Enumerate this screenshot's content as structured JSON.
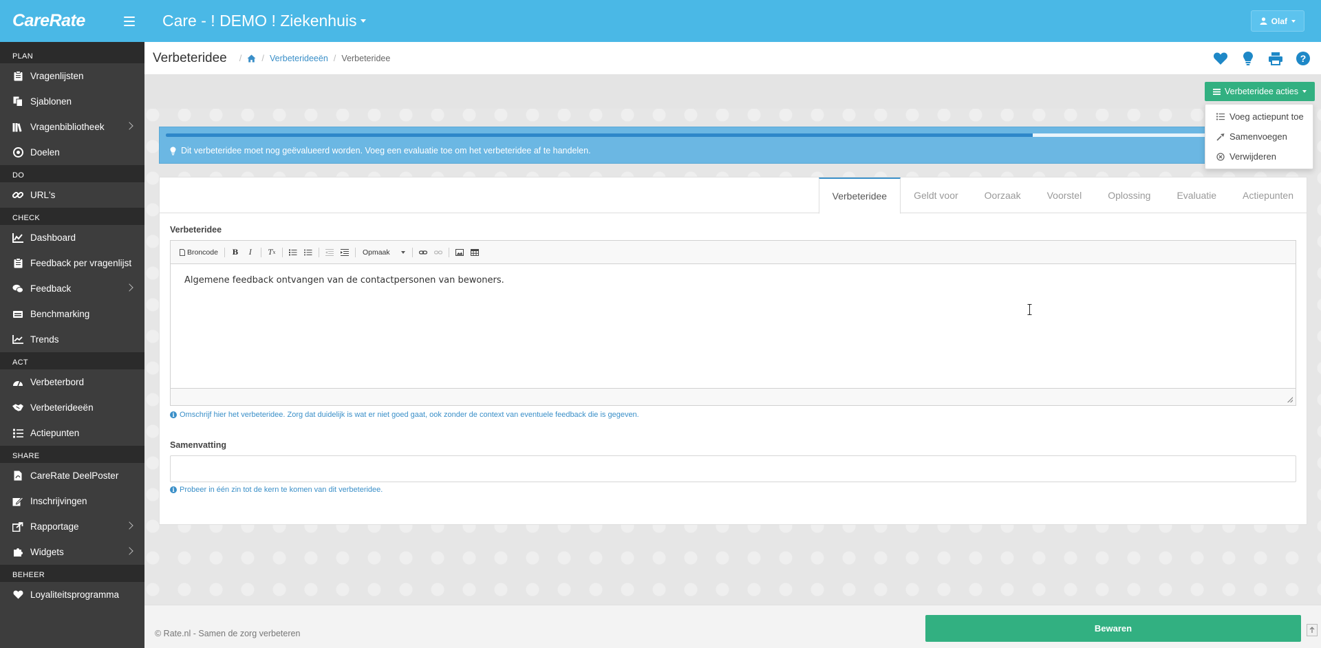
{
  "header": {
    "brand": "CareRate",
    "site_title": "Care - ! DEMO ! Ziekenhuis",
    "user": "Olaf"
  },
  "sidebar": {
    "sections": [
      {
        "title": "PLAN",
        "items": [
          {
            "label": "Vragenlijsten",
            "icon": "clipboard-icon",
            "submenu": false
          },
          {
            "label": "Sjablonen",
            "icon": "copy-icon",
            "submenu": false
          },
          {
            "label": "Vragenbibliotheek",
            "icon": "books-icon",
            "submenu": true
          },
          {
            "label": "Doelen",
            "icon": "target-icon",
            "submenu": false
          }
        ]
      },
      {
        "title": "DO",
        "items": [
          {
            "label": "URL's",
            "icon": "link-icon",
            "submenu": false
          }
        ]
      },
      {
        "title": "CHECK",
        "items": [
          {
            "label": "Dashboard",
            "icon": "chart-icon",
            "submenu": false
          },
          {
            "label": "Feedback per vragenlijst",
            "icon": "clipboard-icon",
            "submenu": false
          },
          {
            "label": "Feedback",
            "icon": "comments-icon",
            "submenu": true
          },
          {
            "label": "Benchmarking",
            "icon": "balance-icon",
            "submenu": false
          },
          {
            "label": "Trends",
            "icon": "trend-icon",
            "submenu": false
          }
        ]
      },
      {
        "title": "ACT",
        "items": [
          {
            "label": "Verbeterbord",
            "icon": "gauge-icon",
            "submenu": false
          },
          {
            "label": "Verbeterideeën",
            "icon": "handshake-icon",
            "submenu": false
          },
          {
            "label": "Actiepunten",
            "icon": "tasks-icon",
            "submenu": false
          }
        ]
      },
      {
        "title": "SHARE",
        "items": [
          {
            "label": "CareRate DeelPoster",
            "icon": "pdf-icon",
            "submenu": false
          },
          {
            "label": "Inschrijvingen",
            "icon": "signup-icon",
            "submenu": false
          },
          {
            "label": "Rapportage",
            "icon": "export-icon",
            "submenu": true
          },
          {
            "label": "Widgets",
            "icon": "puzzle-icon",
            "submenu": true
          }
        ]
      },
      {
        "title": "BEHEER",
        "items": [
          {
            "label": "Loyaliteitsprogramma",
            "icon": "heart-icon",
            "submenu": false
          }
        ]
      }
    ]
  },
  "page": {
    "title": "Verbeteridee",
    "breadcrumb": {
      "link": "Verbeterideeën",
      "current": "Verbeteridee"
    },
    "head_icons": [
      "heart-icon",
      "lightbulb-icon",
      "print-icon",
      "help-icon"
    ]
  },
  "actions": {
    "button_label": "Verbeteridee acties",
    "menu": [
      {
        "label": "Voeg actiepunt toe",
        "icon": "tasks-icon"
      },
      {
        "label": "Samenvoegen",
        "icon": "merge-icon"
      },
      {
        "label": "Verwijderen",
        "icon": "remove-icon"
      }
    ]
  },
  "alert": {
    "text": "Dit verbeteridee moet nog geëvalueerd worden. Voeg een evaluatie toe om het verbeteridee af te handelen.",
    "progress": 0.768
  },
  "tabs": [
    {
      "label": "Verbeteridee",
      "active": true
    },
    {
      "label": "Geldt voor",
      "active": false
    },
    {
      "label": "Oorzaak",
      "active": false
    },
    {
      "label": "Voorstel",
      "active": false
    },
    {
      "label": "Oplossing",
      "active": false
    },
    {
      "label": "Evaluatie",
      "active": false
    },
    {
      "label": "Actiepunten",
      "active": false
    }
  ],
  "form": {
    "idea_label": "Verbeteridee",
    "toolbar": {
      "source": "Broncode",
      "format": "Opmaak"
    },
    "idea_text": "Algemene feedback ontvangen van de contactpersonen van bewoners.",
    "idea_help": "Omschrijf hier het verbeteridee. Zorg dat duidelijk is wat er niet goed gaat, ook zonder de context van eventuele feedback die is gegeven.",
    "summary_label": "Samenvatting",
    "summary_value": "",
    "summary_help": "Probeer in één zin tot de kern te komen van dit verbeteridee."
  },
  "footer": {
    "text": "© Rate.nl - Samen de zorg verbeteren",
    "save_label": "Bewaren"
  },
  "colors": {
    "header": "#4ab8e6",
    "sidebar": "#3d3d3d",
    "accent_green": "#32b081",
    "link_blue": "#3a8fc8"
  }
}
